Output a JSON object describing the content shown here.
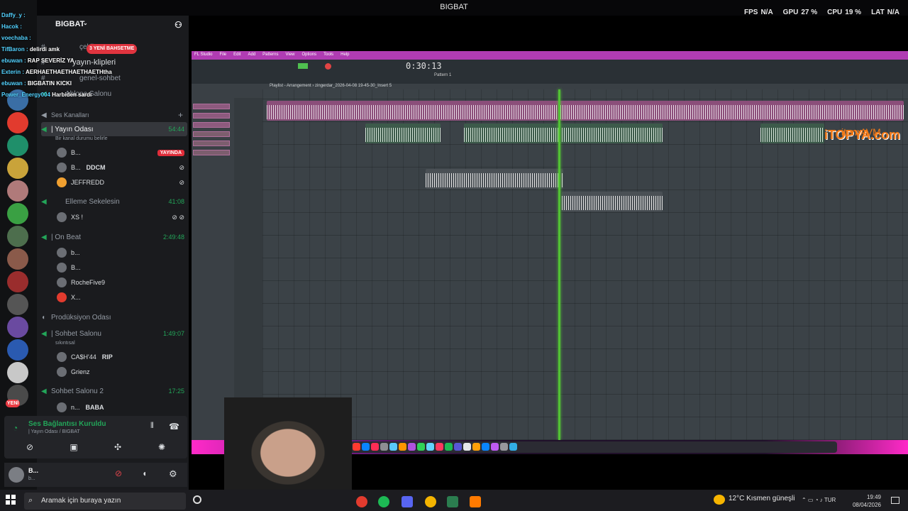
{
  "window": {
    "title": "BIGBAT"
  },
  "stats": {
    "fps_label": "FPS",
    "fps": "N/A",
    "gpu_label": "GPU",
    "gpu": "27 %",
    "cpu_label": "CPU",
    "cpu": "19 %",
    "lat_label": "LAT",
    "lat": "N/A"
  },
  "server": {
    "name": "BIGBAT"
  },
  "chat": [
    {
      "user": "Daffy_y :",
      "msg": ""
    },
    {
      "user": "Hacok :",
      "msg": ""
    },
    {
      "user": "voechaba :",
      "msg": ""
    },
    {
      "user": "TifBaron :",
      "msg": "delirdi amk"
    },
    {
      "user": "ebuwan :",
      "msg": "RAP SEVERİZ YA"
    },
    {
      "user": "Exterin :",
      "msg": "AERHAETHAETHAETHAETHtha"
    },
    {
      "user": "ebuwan :",
      "msg": "BIGBATIN KICKI"
    },
    {
      "user": "Power_Energy004",
      "msg": "Harbiden sardı"
    }
  ],
  "new_bets": "3 YENİ BAHSETME",
  "channels": {
    "text1": "çekil",
    "clips": "yayın-klipleri",
    "general": "genel-sohbet",
    "lounge": "Ablone Salonu",
    "voice_category": "Ses Kanalları",
    "stream_room": "| Yayın Odası",
    "stream_room_time": "54:44",
    "stream_room_status": "Bir kanal durumu belirle",
    "stream_members": [
      {
        "name": "B...",
        "badge": "YAYINDA"
      },
      {
        "name": "B...",
        "tag": "DDCM"
      },
      {
        "name": "JEFFREDD"
      }
    ],
    "elleme": "Elleme Sekelesin",
    "elleme_time": "41:08",
    "elleme_members": [
      {
        "name": "XS !"
      }
    ],
    "onbeat": "| On Beat",
    "onbeat_time": "2:49:48",
    "onbeat_members": [
      {
        "name": "b..."
      },
      {
        "name": "B..."
      },
      {
        "name": "RocheFive9"
      },
      {
        "name": "X..."
      }
    ],
    "production": "Prodüksiyon Odası",
    "sohbet": "| Sohbet Salonu",
    "sohbet_time": "1:49:07",
    "sohbet_status": "sıkıntısal",
    "sohbet_members": [
      {
        "name": "CA$H'44",
        "tag": "RIP"
      },
      {
        "name": "Grienz"
      }
    ],
    "sohbet2": "Sohbet Salonu 2",
    "sohbet2_time": "17:25",
    "sohbet2_members": [
      {
        "name": "n...",
        "tag": "BABA"
      }
    ]
  },
  "voice": {
    "status": "Ses Bağlantısı Kuruldu",
    "sub": "| Yayın Odası / BIGBAT"
  },
  "user": {
    "name": "B...",
    "status": "b..."
  },
  "guild_badges": {
    "new": "YENİ"
  },
  "fl": {
    "menu": [
      "FL Studio",
      "File",
      "Edit",
      "Add",
      "Patterns",
      "View",
      "Options",
      "Tools",
      "Help"
    ],
    "time": "0:30:13",
    "pattern": "Pattern 1",
    "playlist_title": "Playlist - Arrangement › zingerdar_2026-04-08 19-45-30_Insert 5"
  },
  "sponsor": {
    "itopya": "iTOPYA.com",
    "itemavm": "itemAVM"
  },
  "taskbar": {
    "search_placeholder": "Aramak için buraya yazın",
    "weather": "12°C  Kısmen güneşli",
    "lang": "TUR",
    "time": "19:49",
    "date": "08/04/2026"
  }
}
